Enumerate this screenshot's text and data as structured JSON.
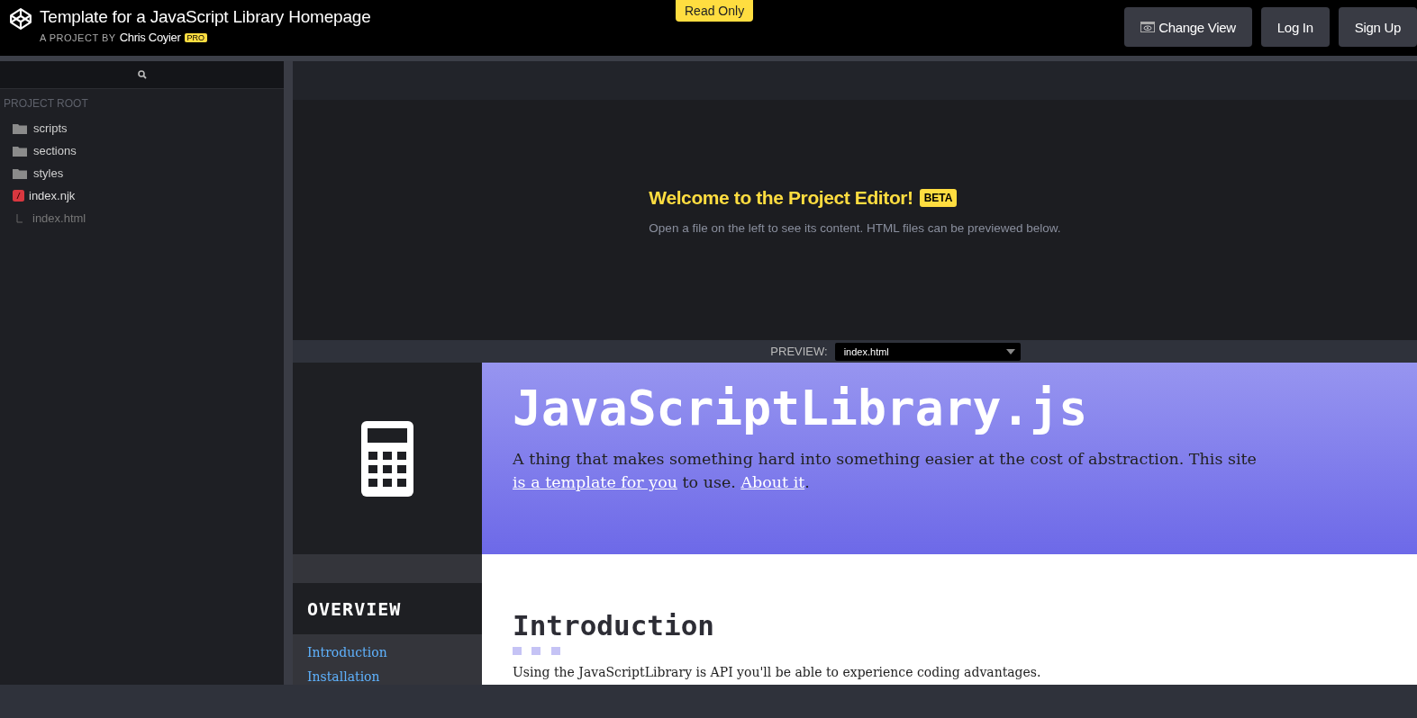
{
  "header": {
    "title": "Template for a JavaScript Library Homepage",
    "byline": "A PROJECT BY",
    "author": "Chris Coyier",
    "author_badge": "PRO",
    "mode_badge": "Read Only",
    "buttons": [
      {
        "label": "Change View",
        "kind": "view"
      },
      {
        "label": "Log In",
        "kind": "plain"
      },
      {
        "label": "Sign Up",
        "kind": "plain"
      }
    ]
  },
  "sidebar": {
    "heading": "PROJECT ROOT",
    "items": [
      {
        "label": "scripts",
        "kind": "folder"
      },
      {
        "label": "sections",
        "kind": "folder"
      },
      {
        "label": "styles",
        "kind": "folder"
      },
      {
        "label": "index.njk",
        "kind": "template",
        "children": [
          {
            "label": "index.html",
            "kind": "output"
          }
        ]
      }
    ]
  },
  "editor": {
    "welcome": "Welcome to the Project Editor!",
    "badge": "BETA",
    "hint": "Open a file on the left to see its content. HTML files can be previewed below."
  },
  "preview": {
    "label": "PREVIEW:",
    "file": "index.html",
    "site": {
      "title": "JavaScriptLibrary.js",
      "intro_parts": [
        {
          "text": "A thing that makes something hard into something easier at the cost of abstraction. This site ",
          "kind": "text"
        },
        {
          "text": "is a template for you",
          "kind": "link"
        },
        {
          "text": " to use. ",
          "kind": "text"
        },
        {
          "text": "About it",
          "kind": "link"
        },
        {
          "text": ".",
          "kind": "text"
        }
      ],
      "nav_heading": "OVERVIEW",
      "nav_items": [
        "Introduction",
        "Installation"
      ],
      "section_title": "Introduction",
      "section_text": "Using the JavaScriptLibrary is API you'll be able to experience coding advantages."
    }
  }
}
